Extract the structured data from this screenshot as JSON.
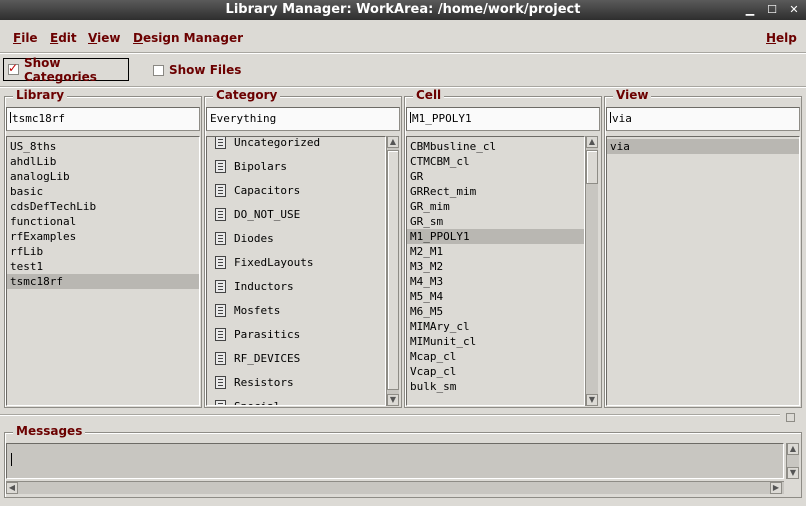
{
  "window": {
    "title": "Library Manager: WorkArea: /home/work/project",
    "minimize_glyph": "▁",
    "maximize_glyph": "☐",
    "close_glyph": "✕"
  },
  "menu": {
    "file": "File",
    "edit": "Edit",
    "view": "View",
    "design_manager": "Design Manager",
    "help": "Help"
  },
  "options": {
    "show_categories": {
      "label": "Show Categories",
      "checked": true
    },
    "show_files": {
      "label": "Show Files",
      "checked": false
    }
  },
  "library": {
    "label": "Library",
    "value": "tsmc18rf",
    "items": [
      "US_8ths",
      "ahdlLib",
      "analogLib",
      "basic",
      "cdsDefTechLib",
      "functional",
      "rfExamples",
      "rfLib",
      "test1",
      "tsmc18rf"
    ],
    "selected_index": 9
  },
  "category": {
    "label": "Category",
    "value": "Everything",
    "items": [
      "Uncategorized",
      "Bipolars",
      "Capacitors",
      "DO_NOT_USE",
      "Diodes",
      "FixedLayouts",
      "Inductors",
      "Mosfets",
      "Parasitics",
      "RF_DEVICES",
      "Resistors",
      "Special"
    ]
  },
  "cell": {
    "label": "Cell",
    "value": "M1_PPOLY1",
    "items": [
      "CBMbusline_cl",
      "CTMCBM_cl",
      "GR",
      "GRRect_mim",
      "GR_mim",
      "GR_sm",
      "M1_PPOLY1",
      "M2_M1",
      "M3_M2",
      "M4_M3",
      "M5_M4",
      "M6_M5",
      "MIMAry_cl",
      "MIMunit_cl",
      "Mcap_cl",
      "Vcap_cl",
      "bulk_sm"
    ],
    "selected_index": 6
  },
  "view": {
    "label": "View",
    "value": "via",
    "items": [
      "via"
    ],
    "selected_index": 0
  },
  "messages": {
    "label": "Messages",
    "text": ""
  },
  "colors": {
    "title_bar": "#2e2e2e",
    "label_text": "#6b0000",
    "check_mark": "#c00000",
    "selection": "#b9b7b2"
  },
  "scroll_glyphs": {
    "up": "▲",
    "down": "▼",
    "left": "◀",
    "right": "▶"
  }
}
